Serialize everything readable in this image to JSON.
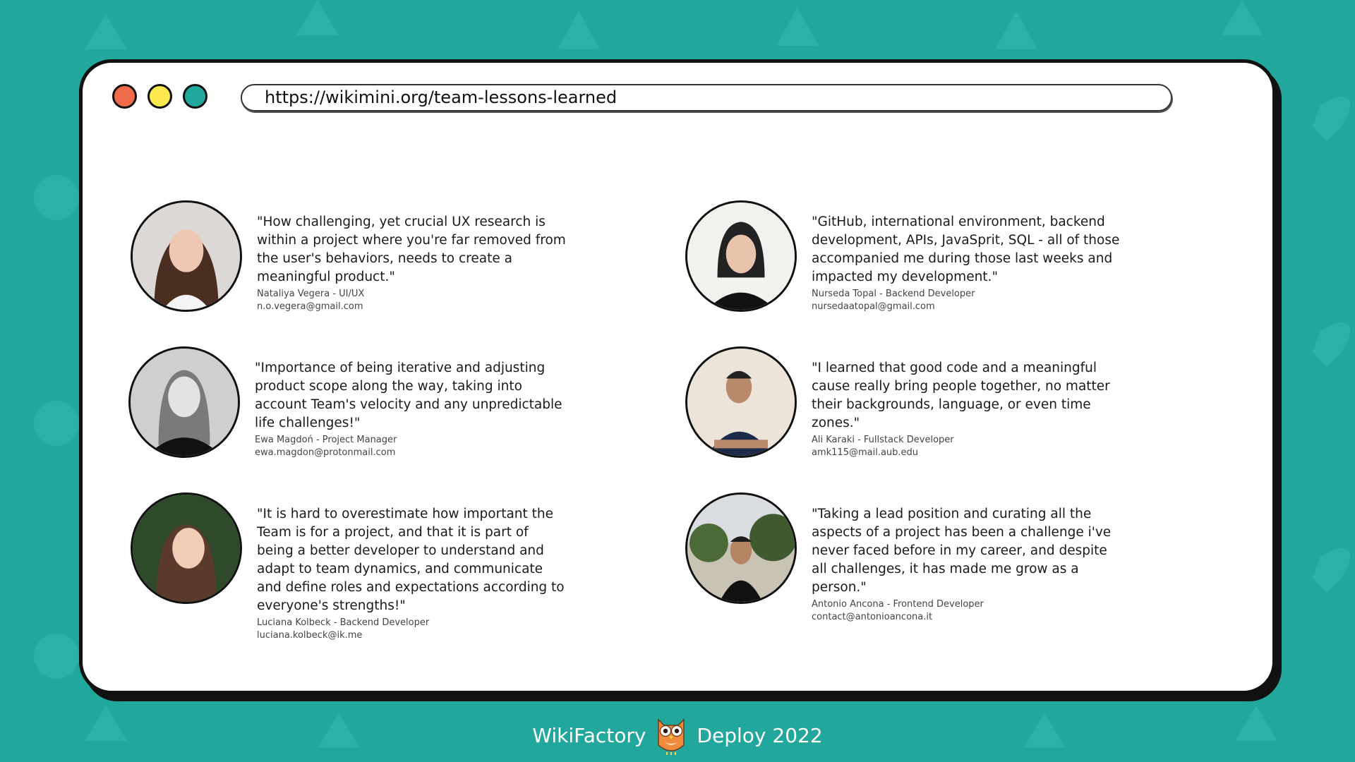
{
  "browser": {
    "url": "https://wikimini.org/team-lessons-learned",
    "dot_colors": [
      "#ef6b4a",
      "#fde84f",
      "#22a79c"
    ]
  },
  "testimonials": [
    {
      "quote": "\"How challenging, yet crucial UX research is within a project where you're far removed from the user's behaviors, needs to create a meaningful product.\"",
      "name_role": "Nataliya Vegera - UI/UX",
      "email": "n.o.vegera@gmail.com"
    },
    {
      "quote": "\"GitHub, international environment, backend development, APIs, JavaSprit, SQL - all of those accompanied me during those last weeks and impacted my development.\"",
      "name_role": "Nurseda Topal - Backend Developer",
      "email": "nursedaatopal@gmail.com"
    },
    {
      "quote": "\"Importance of being iterative and adjusting product scope along the way, taking into account Team's velocity and any unpredictable life challenges!\"",
      "name_role": "Ewa Magdoń - Project Manager",
      "email": "ewa.magdon@protonmail.com"
    },
    {
      "quote": "\"I learned that good code and a meaningful cause really bring people together, no matter their backgrounds, language, or even time zones.\"",
      "name_role": "Ali Karaki - Fullstack Developer",
      "email": "amk115@mail.aub.edu"
    },
    {
      "quote": "\"It is hard to overestimate how important the Team is for a project, and that it is part of being a better developer to understand and adapt to team dynamics, and communicate and define roles and expectations according to everyone's strengths!\"",
      "name_role": "Luciana Kolbeck - Backend Developer",
      "email": "luciana.kolbeck@ik.me"
    },
    {
      "quote": "\"Taking a lead position and curating all the aspects of a project has been a challenge i've never faced before in my career, and despite all challenges, it has made me grow as a person.\"",
      "name_role": "Antonio Ancona - Frontend Developer",
      "email": "contact@antonioancona.it"
    }
  ],
  "footer": {
    "left": "WikiFactory",
    "right": "Deploy 2022",
    "icon": "owl-icon"
  },
  "colors": {
    "background": "#22a79c",
    "window": "#ffffff"
  }
}
